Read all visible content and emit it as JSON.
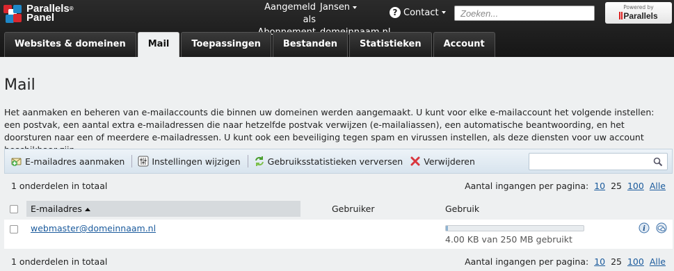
{
  "brand": {
    "line1": "Parallels",
    "line2": "Panel",
    "reg": "®"
  },
  "user": {
    "logged_in_label": "Aangemeld als",
    "logged_in_value": "Jansen",
    "subscription_label": "Abonnement",
    "subscription_value": "domeinnaam.nl"
  },
  "contact_label": "Contact",
  "search": {
    "placeholder": "Zoeken..."
  },
  "powered_by": {
    "small": "Powered by",
    "brand": "Parallels"
  },
  "tabs": [
    {
      "label": "Websites & domeinen"
    },
    {
      "label": "Mail",
      "active": true
    },
    {
      "label": "Toepassingen"
    },
    {
      "label": "Bestanden"
    },
    {
      "label": "Statistieken"
    },
    {
      "label": "Account"
    }
  ],
  "page": {
    "title": "Mail",
    "description": "Het aanmaken en beheren van e-mailaccounts die binnen uw domeinen werden aangemaakt. U kunt voor elke e-mailaccount het volgende instellen: een postvak, een aantal extra e-mailadressen die naar hetzelfde postvak verwijzen (e-mailaliassen), een automatische beantwoording, en het doorsturen naar een of meerdere e-mailadressen. U kunt ook een beveiliging tegen spam en virussen instellen, als deze diensten voor uw account beschikbaar zijn."
  },
  "toolbar": {
    "create": "E-mailadres aanmaken",
    "settings": "Instellingen wijzigen",
    "refresh": "Gebruiksstatistieken verversen",
    "delete": "Verwijderen"
  },
  "list": {
    "total": "1 onderdelen in totaal",
    "per_page_label": "Aantal ingangen per pagina:",
    "per_page_options": [
      "10",
      "25",
      "100",
      "Alle"
    ],
    "per_page_current": "25",
    "columns": {
      "email": "E-mailadres",
      "user": "Gebruiker",
      "usage": "Gebruik"
    },
    "rows": [
      {
        "email": "webmaster@domeinnaam.nl",
        "user": "",
        "usage_text": "4.00 KB van 250 MB gebruikt",
        "usage_fraction": 0.016
      }
    ]
  },
  "colors": {
    "accent_link": "#1a5a9c",
    "header_bg": "#1c1c1c",
    "toolbar_bg": "#dde8f1"
  }
}
